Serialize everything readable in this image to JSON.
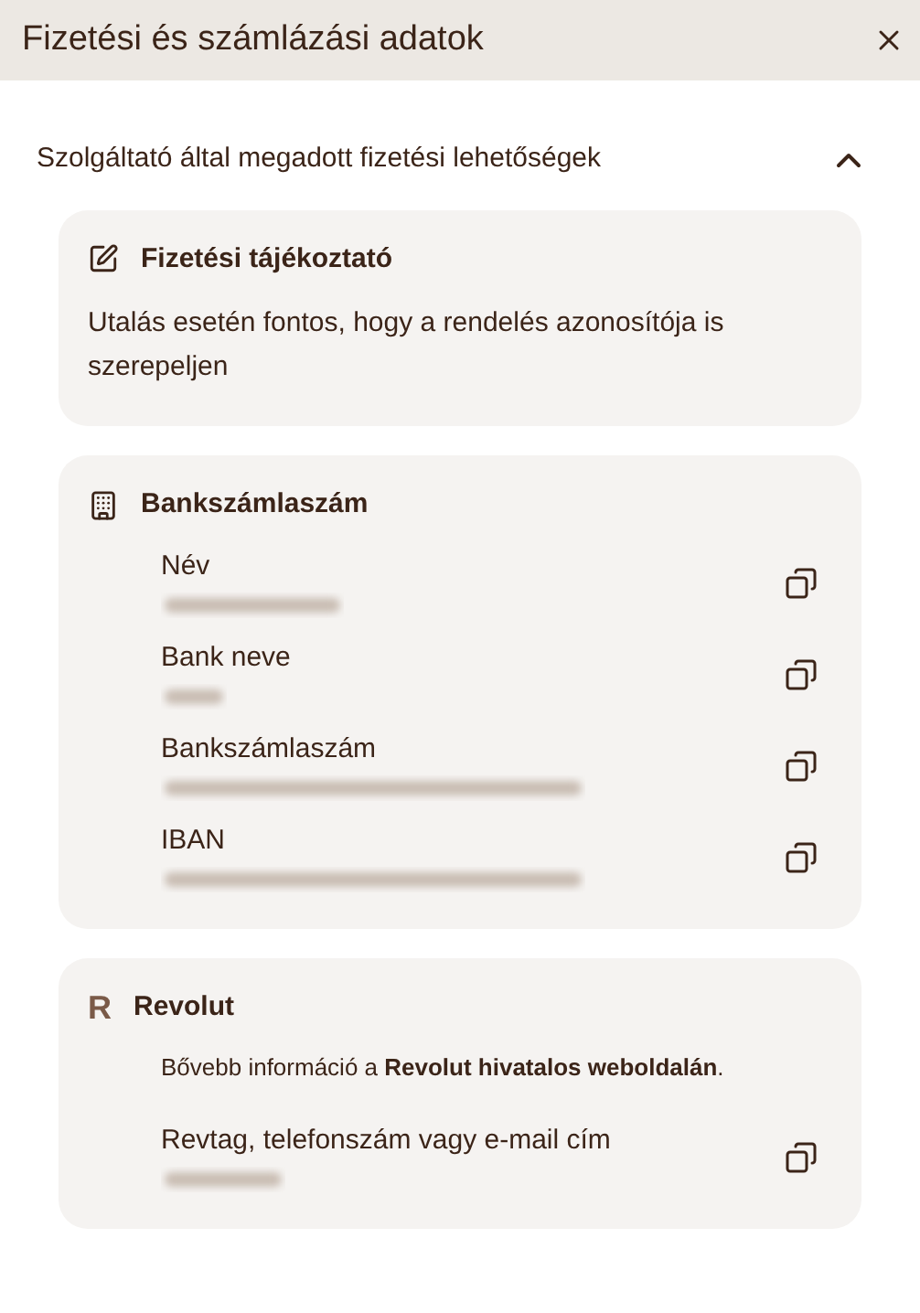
{
  "window": {
    "title": "Fizetési és számlázási adatok"
  },
  "section": {
    "title": "Szolgáltató által megadott fizetési lehetőségek",
    "expanded": true
  },
  "cards": [
    {
      "kind": "info",
      "title": "Fizetési tájékoztató",
      "text": "Utalás esetén fontos, hogy a rendelés azonosítója is szerepeljen"
    },
    {
      "kind": "bank",
      "title": "Bankszámlaszám",
      "fields": [
        {
          "label": "Név"
        },
        {
          "label": "Bank neve"
        },
        {
          "label": "Bankszámlaszám"
        },
        {
          "label": "IBAN"
        }
      ]
    },
    {
      "kind": "revolut",
      "title": "Revolut",
      "logo": "R",
      "note_before": "Bővebb információ a ",
      "link": "Revolut hivatalos weboldalán",
      "note_after": ".",
      "fields": [
        {
          "label": "Revtag, telefonszám vagy e-mail cím"
        }
      ]
    }
  ]
}
